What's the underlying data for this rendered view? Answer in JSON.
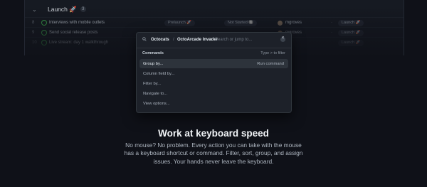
{
  "board": {
    "group_title": "Launch 🚀",
    "group_count": "3",
    "rows": [
      {
        "index": "8",
        "title": "Interviews with mobile outlets",
        "label": "Prelaunch 🚀",
        "status": "Not Started 🔘",
        "user": "mgroves",
        "iteration": "Launch 🚀"
      },
      {
        "index": "9",
        "title": "Send social release posts",
        "label": "",
        "status": "",
        "user": "mgroves",
        "iteration": "Launch 🚀"
      },
      {
        "index": "10",
        "title": "Live stream: day 1 walkthrough",
        "label": "",
        "status": "",
        "user": "",
        "iteration": "Launch 🚀"
      }
    ]
  },
  "palette": {
    "crumbs": [
      "Octocats",
      "OctoArcade Invader"
    ],
    "search_placeholder": "Search or jump to...",
    "section_label": "Commands",
    "section_hint": "Type > to filter",
    "commands": [
      {
        "label": "Group by...",
        "action": "Run command"
      },
      {
        "label": "Column field by..."
      },
      {
        "label": "Filter by..."
      },
      {
        "label": "Navigate to..."
      },
      {
        "label": "View options..."
      }
    ]
  },
  "feature": {
    "headline": "Work at keyboard speed",
    "body": "No mouse? No problem. Every action you can take with the mouse has a keyboard shortcut or command. Filter, sort, group, and assign issues. Your hands never leave the keyboard."
  }
}
